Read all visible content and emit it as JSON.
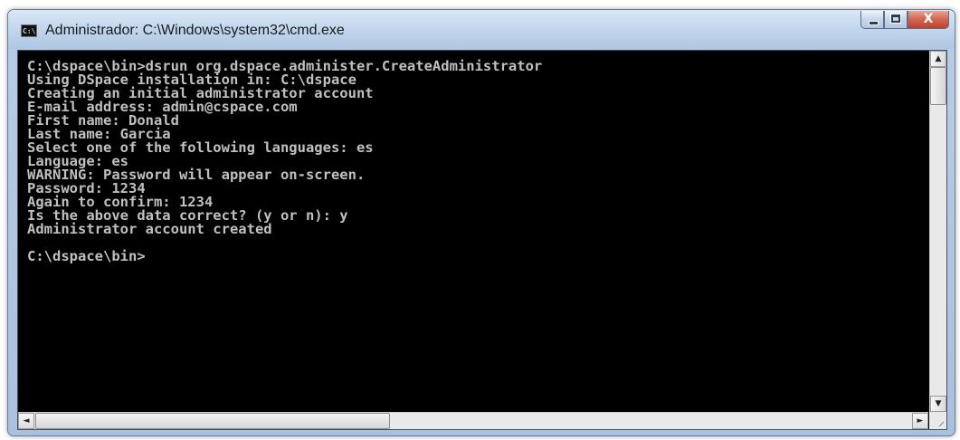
{
  "window": {
    "title": "Administrador: C:\\Windows\\system32\\cmd.exe",
    "icon_label": "C:\\",
    "buttons": {
      "minimize": "minimize",
      "maximize": "maximize",
      "close": "X"
    }
  },
  "console": {
    "lines": [
      "C:\\dspace\\bin>dsrun org.dspace.administer.CreateAdministrator",
      "Using DSpace installation in: C:\\dspace",
      "Creating an initial administrator account",
      "E-mail address: admin@cspace.com",
      "First name: Donald",
      "Last name: Garcia",
      "Select one of the following languages: es",
      "Language: es",
      "WARNING: Password will appear on-screen.",
      "Password: 1234",
      "Again to confirm: 1234",
      "Is the above data correct? (y or n): y",
      "Administrator account created",
      "",
      "C:\\dspace\\bin>"
    ]
  },
  "scrollbars": {
    "vertical_up": "▲",
    "vertical_down": "▼",
    "horizontal_left": "◄",
    "horizontal_right": "►"
  },
  "colors": {
    "console_bg": "#000000",
    "console_fg": "#c0c0c0",
    "close_button": "#c0402a"
  }
}
